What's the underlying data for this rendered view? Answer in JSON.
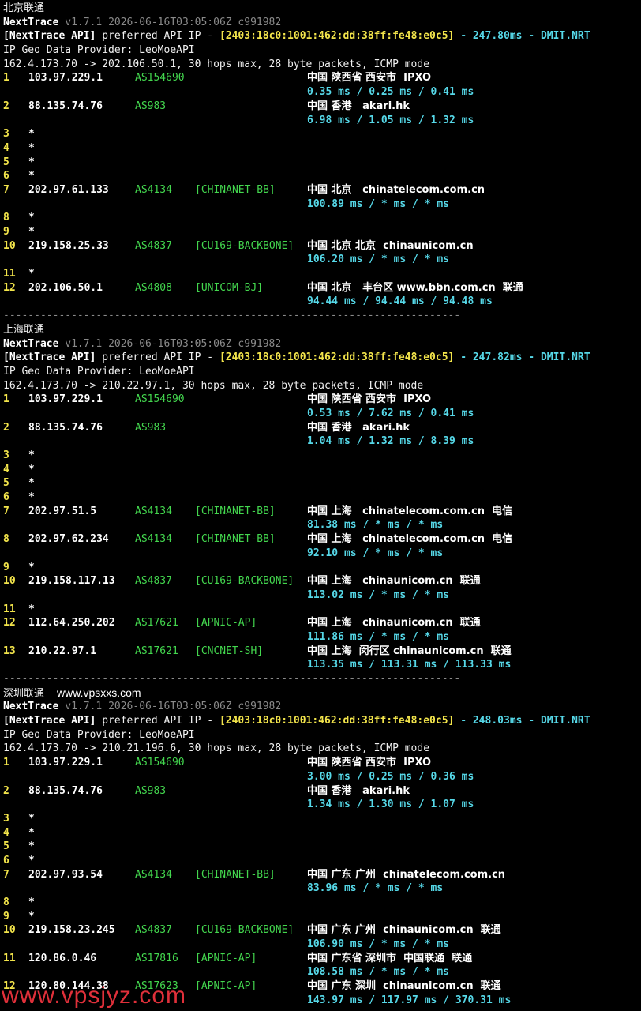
{
  "sections": [
    {
      "title": "北京联通",
      "watermark": "",
      "tool": "NextTrace",
      "version_line": "v1.7.1 2026-06-16T03:05:06Z c991982",
      "api_label": "[NextTrace API]",
      "api_text": " preferred API IP - ",
      "api_ip": "[2403:18c0:1001:462:dd:38ff:fe48:e0c5]",
      "api_latency": " - 247.80ms - DMIT.NRT",
      "geo_provider": "IP Geo Data Provider: LeoMoeAPI",
      "trace_line": "162.4.173.70 -> 202.106.50.1, 30 hops max, 28 byte packets, ICMP mode",
      "hops": [
        {
          "hop": "1",
          "ip": "103.97.229.1",
          "as": "AS154690",
          "tag": "",
          "geo": "中国 陕西省 西安市  IPXO",
          "rtt": "0.35 ms / 0.25 ms / 0.41 ms"
        },
        {
          "hop": "2",
          "ip": "88.135.74.76",
          "as": "AS983",
          "tag": "",
          "geo": "中国 香港   akari.hk",
          "rtt": "6.98 ms / 1.05 ms / 1.32 ms"
        },
        {
          "hop": "3",
          "ip": "*"
        },
        {
          "hop": "4",
          "ip": "*"
        },
        {
          "hop": "5",
          "ip": "*"
        },
        {
          "hop": "6",
          "ip": "*"
        },
        {
          "hop": "7",
          "ip": "202.97.61.133",
          "as": "AS4134",
          "tag": "[CHINANET-BB]",
          "geo": "中国 北京   chinatelecom.com.cn",
          "rtt": "100.89 ms / * ms / * ms"
        },
        {
          "hop": "8",
          "ip": "*"
        },
        {
          "hop": "9",
          "ip": "*"
        },
        {
          "hop": "10",
          "ip": "219.158.25.33",
          "as": "AS4837",
          "tag": "[CU169-BACKBONE]",
          "geo": "中国 北京 北京  chinaunicom.cn",
          "rtt": "106.20 ms / * ms / * ms"
        },
        {
          "hop": "11",
          "ip": "*"
        },
        {
          "hop": "12",
          "ip": "202.106.50.1",
          "as": "AS4808",
          "tag": "[UNICOM-BJ]",
          "geo": "中国 北京   丰台区 www.bbn.com.cn  联通",
          "rtt": "94.44 ms / 94.44 ms / 94.48 ms"
        }
      ]
    },
    {
      "title": "上海联通",
      "watermark": "",
      "tool": "NextTrace",
      "version_line": "v1.7.1 2026-06-16T03:05:06Z c991982",
      "api_label": "[NextTrace API]",
      "api_text": " preferred API IP - ",
      "api_ip": "[2403:18c0:1001:462:dd:38ff:fe48:e0c5]",
      "api_latency": " - 247.82ms - DMIT.NRT",
      "geo_provider": "IP Geo Data Provider: LeoMoeAPI",
      "trace_line": "162.4.173.70 -> 210.22.97.1, 30 hops max, 28 byte packets, ICMP mode",
      "hops": [
        {
          "hop": "1",
          "ip": "103.97.229.1",
          "as": "AS154690",
          "tag": "",
          "geo": "中国 陕西省 西安市  IPXO",
          "rtt": "0.53 ms / 7.62 ms / 0.41 ms"
        },
        {
          "hop": "2",
          "ip": "88.135.74.76",
          "as": "AS983",
          "tag": "",
          "geo": "中国 香港   akari.hk",
          "rtt": "1.04 ms / 1.32 ms / 8.39 ms"
        },
        {
          "hop": "3",
          "ip": "*"
        },
        {
          "hop": "4",
          "ip": "*"
        },
        {
          "hop": "5",
          "ip": "*"
        },
        {
          "hop": "6",
          "ip": "*"
        },
        {
          "hop": "7",
          "ip": "202.97.51.5",
          "as": "AS4134",
          "tag": "[CHINANET-BB]",
          "geo": "中国 上海   chinatelecom.com.cn  电信",
          "rtt": "81.38 ms / * ms / * ms"
        },
        {
          "hop": "8",
          "ip": "202.97.62.234",
          "as": "AS4134",
          "tag": "[CHINANET-BB]",
          "geo": "中国 上海   chinatelecom.com.cn  电信",
          "rtt": "92.10 ms / * ms / * ms"
        },
        {
          "hop": "9",
          "ip": "*"
        },
        {
          "hop": "10",
          "ip": "219.158.117.13",
          "as": "AS4837",
          "tag": "[CU169-BACKBONE]",
          "geo": "中国 上海   chinaunicom.cn  联通",
          "rtt": "113.02 ms / * ms / * ms"
        },
        {
          "hop": "11",
          "ip": "*"
        },
        {
          "hop": "12",
          "ip": "112.64.250.202",
          "as": "AS17621",
          "tag": "[APNIC-AP]",
          "geo": "中国 上海   chinaunicom.cn  联通",
          "rtt": "111.86 ms / * ms / * ms"
        },
        {
          "hop": "13",
          "ip": "210.22.97.1",
          "as": "AS17621",
          "tag": "[CNCNET-SH]",
          "geo": "中国 上海  闵行区 chinaunicom.cn  联通",
          "rtt": "113.35 ms / 113.31 ms / 113.33 ms"
        }
      ]
    },
    {
      "title": "深圳联通",
      "watermark": "www.vpsxxs.com",
      "tool": "NextTrace",
      "version_line": "v1.7.1 2026-06-16T03:05:06Z c991982",
      "api_label": "[NextTrace API]",
      "api_text": " preferred API IP - ",
      "api_ip": "[2403:18c0:1001:462:dd:38ff:fe48:e0c5]",
      "api_latency": " - 248.03ms - DMIT.NRT",
      "geo_provider": "IP Geo Data Provider: LeoMoeAPI",
      "trace_line": "162.4.173.70 -> 210.21.196.6, 30 hops max, 28 byte packets, ICMP mode",
      "hops": [
        {
          "hop": "1",
          "ip": "103.97.229.1",
          "as": "AS154690",
          "tag": "",
          "geo": "中国 陕西省 西安市  IPXO",
          "rtt": "3.00 ms / 0.25 ms / 0.36 ms"
        },
        {
          "hop": "2",
          "ip": "88.135.74.76",
          "as": "AS983",
          "tag": "",
          "geo": "中国 香港   akari.hk",
          "rtt": "1.34 ms / 1.30 ms / 1.07 ms"
        },
        {
          "hop": "3",
          "ip": "*"
        },
        {
          "hop": "4",
          "ip": "*"
        },
        {
          "hop": "5",
          "ip": "*"
        },
        {
          "hop": "6",
          "ip": "*"
        },
        {
          "hop": "7",
          "ip": "202.97.93.54",
          "as": "AS4134",
          "tag": "[CHINANET-BB]",
          "geo": "中国 广东 广州  chinatelecom.com.cn",
          "rtt": "83.96 ms / * ms / * ms"
        },
        {
          "hop": "8",
          "ip": "*"
        },
        {
          "hop": "9",
          "ip": "*"
        },
        {
          "hop": "10",
          "ip": "219.158.23.245",
          "as": "AS4837",
          "tag": "[CU169-BACKBONE]",
          "geo": "中国 广东 广州  chinaunicom.cn  联通",
          "rtt": "106.90 ms / * ms / * ms"
        },
        {
          "hop": "11",
          "ip": "120.86.0.46",
          "as": "AS17816",
          "tag": "[APNIC-AP]",
          "geo": "中国 广东省 深圳市  中国联通  联通",
          "rtt": "108.58 ms / * ms / * ms"
        },
        {
          "hop": "12",
          "ip": "120.80.144.38",
          "as": "AS17623",
          "tag": "[APNIC-AP]",
          "geo": "中国 广东 深圳  chinaunicom.cn  联通",
          "rtt": "143.97 ms / 117.97 ms / 370.31 ms"
        }
      ]
    }
  ],
  "separator": "--------------------------------------------------------------------------",
  "watermark_bottom": "www.vpsjyz.com",
  "colors": {
    "background": "#000000",
    "hop_number": "#f2e44b",
    "as_number": "#43d64e",
    "rtt": "#56d8e8",
    "api_ip": "#f2e44b",
    "watermark": "#e0303a"
  }
}
